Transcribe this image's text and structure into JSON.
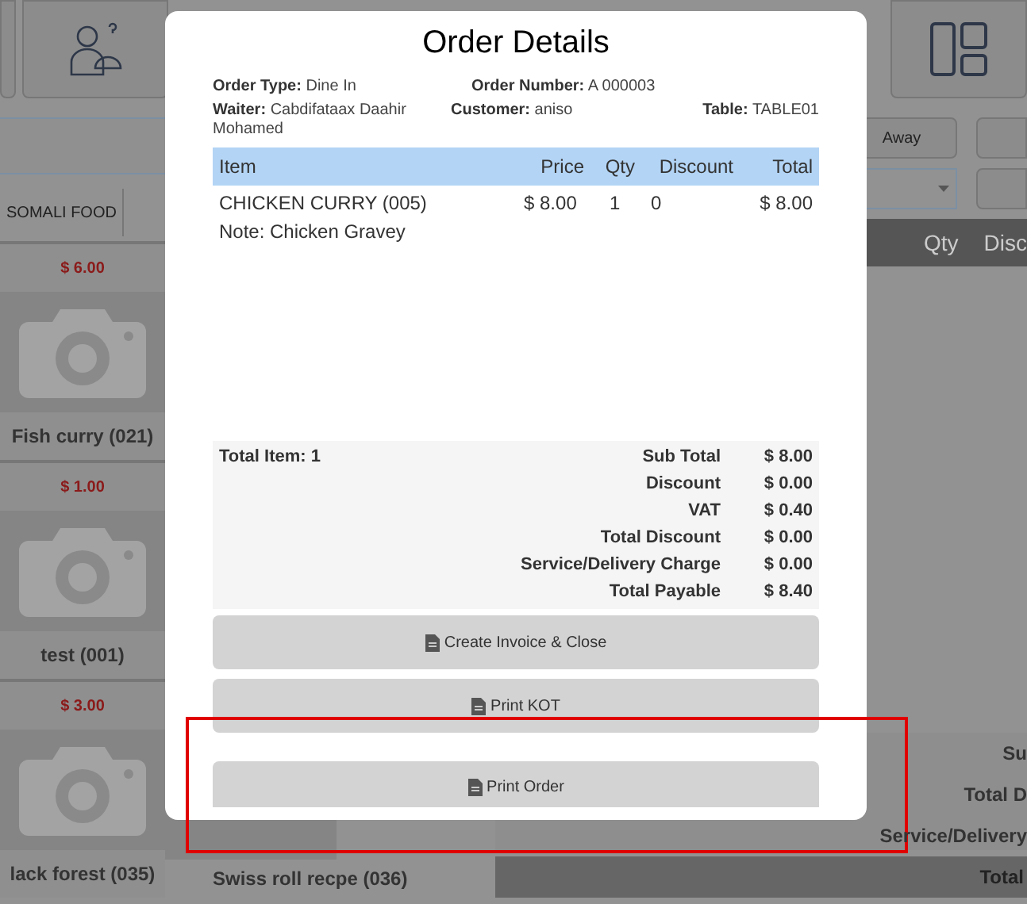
{
  "background": {
    "order_type_button": "Away",
    "category_tab": "SOMALI FOOD",
    "products": [
      {
        "price": "$ 6.00",
        "name": "Fish curry (021)"
      },
      {
        "price": "$ 1.00",
        "name": "test (001)"
      },
      {
        "price": "$ 3.00",
        "name": "lack forest (035)"
      }
    ],
    "second_column_product": "Swiss roll recpe (036)",
    "cart_columns": [
      "Qty",
      "Disc"
    ],
    "summary_labels": [
      "Su",
      "Total D",
      "Service/Delivery"
    ],
    "total_bar": "Total"
  },
  "modal": {
    "title": "Order Details",
    "fields": [
      {
        "label": "Order Type:",
        "value": "Dine In"
      },
      {
        "label": "Order Number:",
        "value": "A 000003"
      },
      {
        "label": "Waiter:",
        "value": "Cabdifataax Daahir Mohamed"
      },
      {
        "label": "Customer:",
        "value": "aniso"
      },
      {
        "label": "Table:",
        "value": "TABLE01"
      }
    ],
    "table": {
      "columns": [
        "Item",
        "Price",
        "Qty",
        "Discount",
        "Total"
      ],
      "rows": [
        {
          "item": "CHICKEN CURRY (005)",
          "price": "$ 8.00",
          "qty": "1",
          "discount": "0",
          "total": "$ 8.00",
          "note": "Note: Chicken Gravey"
        }
      ]
    },
    "total_items": "Total Item: 1",
    "summary": [
      {
        "label": "Sub Total",
        "value": "$ 8.00"
      },
      {
        "label": "Discount",
        "value": "$ 0.00"
      },
      {
        "label": "VAT",
        "value": "$ 0.40"
      },
      {
        "label": "Total Discount",
        "value": "$ 0.00"
      },
      {
        "label": "Service/Delivery Charge",
        "value": "$ 0.00"
      },
      {
        "label": "Total Payable",
        "value": "$ 8.40"
      }
    ],
    "buttons": [
      {
        "label": "Create Invoice & Close"
      },
      {
        "label": "Print KOT"
      },
      {
        "label": "Print Order"
      }
    ]
  }
}
